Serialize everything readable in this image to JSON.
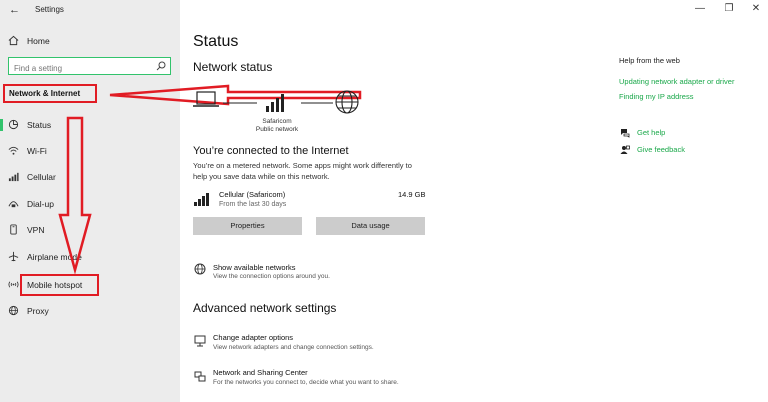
{
  "app": {
    "back": "←",
    "title": "Settings"
  },
  "window": {
    "minimize": "—",
    "restore": "❐",
    "close": "✕"
  },
  "sidebar": {
    "home": "Home",
    "search_placeholder": "Find a setting",
    "section": "Network & Internet",
    "items": [
      {
        "label": "Status",
        "icon": "status-icon"
      },
      {
        "label": "Wi-Fi",
        "icon": "wifi-icon"
      },
      {
        "label": "Cellular",
        "icon": "cellular-icon"
      },
      {
        "label": "Dial-up",
        "icon": "dialup-icon"
      },
      {
        "label": "VPN",
        "icon": "vpn-icon"
      },
      {
        "label": "Airplane mode",
        "icon": "airplane-icon"
      },
      {
        "label": "Mobile hotspot",
        "icon": "hotspot-icon"
      },
      {
        "label": "Proxy",
        "icon": "proxy-icon"
      }
    ]
  },
  "main": {
    "title": "Status",
    "network_status": "Network status",
    "network_name": "Safaricom",
    "network_type": "Public network",
    "connected_heading": "You’re connected to the Internet",
    "metered_line1": "You’re on a metered network. Some apps might work differently to",
    "metered_line2": "help you save data while on this network.",
    "usage": {
      "name": "Cellular (Safaricom)",
      "period": "From the last 30 days",
      "amount": "14.9 GB"
    },
    "buttons": {
      "properties": "Properties",
      "data_usage": "Data usage"
    },
    "show_networks": {
      "title": "Show available networks",
      "sub": "View the connection options around you."
    },
    "advanced_heading": "Advanced network settings",
    "adapter": {
      "title": "Change adapter options",
      "sub": "View network adapters and change connection settings."
    },
    "sharing": {
      "title": "Network and Sharing Center",
      "sub": "For the networks you connect to, decide what you want to share."
    }
  },
  "right": {
    "heading": "Help from the web",
    "links": [
      "Updating network adapter or driver",
      "Finding my IP address"
    ],
    "get_help": "Get help",
    "feedback": "Give feedback"
  },
  "colors": {
    "accent": "#32c36c",
    "annotation": "#e11c24",
    "sidebar_bg": "#ececec"
  }
}
